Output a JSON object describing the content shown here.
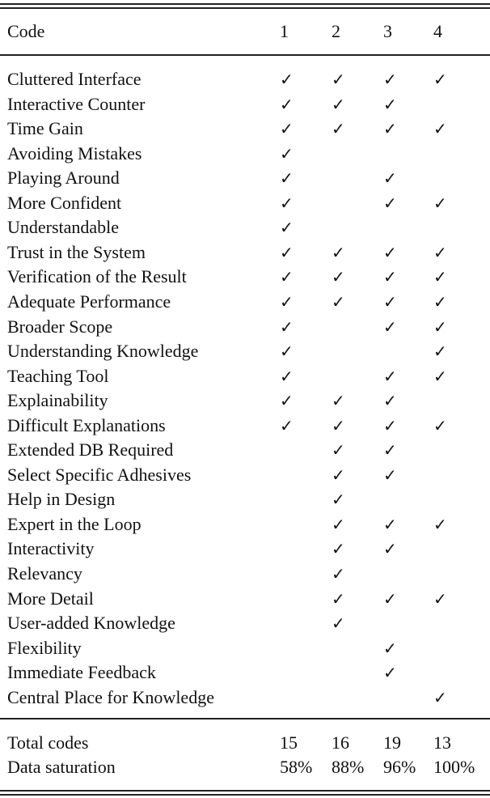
{
  "table": {
    "header": {
      "code_label": "Code",
      "columns": [
        "1",
        "2",
        "3",
        "4"
      ]
    },
    "check_glyph": "✓",
    "rows": [
      {
        "label": "Cluttered Interface",
        "marks": [
          true,
          true,
          true,
          true
        ]
      },
      {
        "label": "Interactive Counter",
        "marks": [
          true,
          true,
          true,
          false
        ]
      },
      {
        "label": "Time Gain",
        "marks": [
          true,
          true,
          true,
          true
        ]
      },
      {
        "label": "Avoiding Mistakes",
        "marks": [
          true,
          false,
          false,
          false
        ]
      },
      {
        "label": "Playing Around",
        "marks": [
          true,
          false,
          true,
          false
        ]
      },
      {
        "label": "More Confident",
        "marks": [
          true,
          false,
          true,
          true
        ]
      },
      {
        "label": "Understandable",
        "marks": [
          true,
          false,
          false,
          false
        ]
      },
      {
        "label": "Trust in the System",
        "marks": [
          true,
          true,
          true,
          true
        ]
      },
      {
        "label": "Verification of the Result",
        "marks": [
          true,
          true,
          true,
          true
        ]
      },
      {
        "label": "Adequate Performance",
        "marks": [
          true,
          true,
          true,
          true
        ]
      },
      {
        "label": "Broader Scope",
        "marks": [
          true,
          false,
          true,
          true
        ]
      },
      {
        "label": "Understanding Knowledge",
        "marks": [
          true,
          false,
          false,
          true
        ]
      },
      {
        "label": "Teaching Tool",
        "marks": [
          true,
          false,
          true,
          true
        ]
      },
      {
        "label": "Explainability",
        "marks": [
          true,
          true,
          true,
          false
        ]
      },
      {
        "label": "Difficult Explanations",
        "marks": [
          true,
          true,
          true,
          true
        ]
      },
      {
        "label": "Extended DB Required",
        "marks": [
          false,
          true,
          true,
          false
        ]
      },
      {
        "label": "Select Specific Adhesives",
        "marks": [
          false,
          true,
          true,
          false
        ]
      },
      {
        "label": "Help in Design",
        "marks": [
          false,
          true,
          false,
          false
        ]
      },
      {
        "label": "Expert in the Loop",
        "marks": [
          false,
          true,
          true,
          true
        ]
      },
      {
        "label": "Interactivity",
        "marks": [
          false,
          true,
          true,
          false
        ]
      },
      {
        "label": "Relevancy",
        "marks": [
          false,
          true,
          false,
          false
        ]
      },
      {
        "label": "More Detail",
        "marks": [
          false,
          true,
          true,
          true
        ]
      },
      {
        "label": "User-added Knowledge",
        "marks": [
          false,
          true,
          false,
          false
        ]
      },
      {
        "label": "Flexibility",
        "marks": [
          false,
          false,
          true,
          false
        ]
      },
      {
        "label": "Immediate Feedback",
        "marks": [
          false,
          false,
          true,
          false
        ]
      },
      {
        "label": "Central Place for Knowledge",
        "marks": [
          false,
          false,
          false,
          true
        ]
      }
    ],
    "footer": [
      {
        "label": "Total codes",
        "values": [
          "15",
          "16",
          "19",
          "13"
        ]
      },
      {
        "label": "Data saturation",
        "values": [
          "58%",
          "88%",
          "96%",
          "100%"
        ]
      }
    ]
  }
}
